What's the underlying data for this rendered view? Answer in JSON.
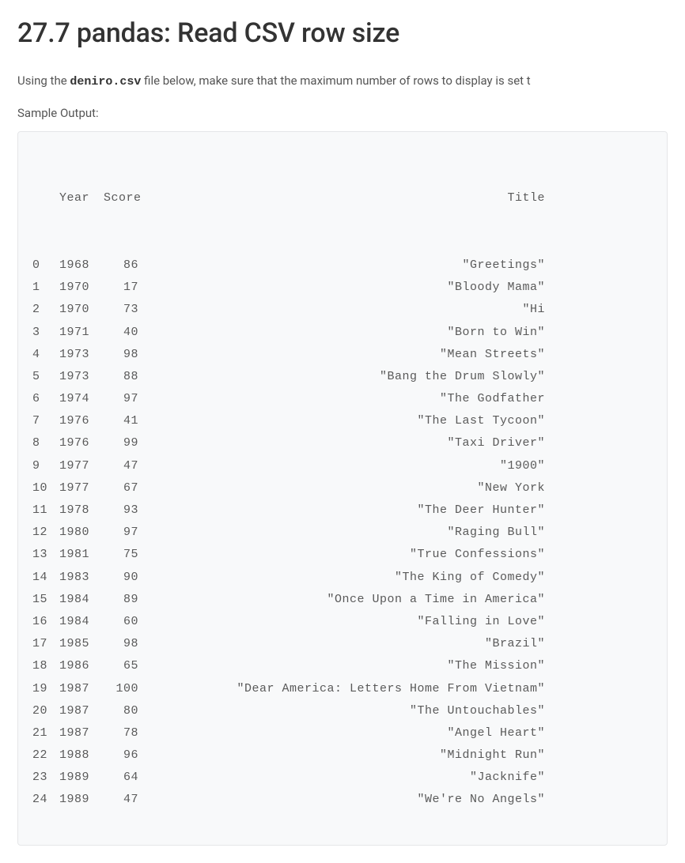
{
  "heading": "27.7 pandas: Read CSV row size",
  "intro_prefix": "Using the ",
  "intro_code": "deniro.csv",
  "intro_suffix": " file below, make sure that the maximum number of rows to display is set t",
  "sample_label": "Sample Output:",
  "chart_data": {
    "type": "table",
    "columns": [
      "Year",
      "Score",
      "Title"
    ],
    "rows": [
      {
        "index": "0",
        "Year": "1968",
        "Score": "86",
        "Title": "\"Greetings\""
      },
      {
        "index": "1",
        "Year": "1970",
        "Score": "17",
        "Title": "\"Bloody Mama\""
      },
      {
        "index": "2",
        "Year": "1970",
        "Score": "73",
        "Title": "\"Hi"
      },
      {
        "index": "3",
        "Year": "1971",
        "Score": "40",
        "Title": "\"Born to Win\""
      },
      {
        "index": "4",
        "Year": "1973",
        "Score": "98",
        "Title": "\"Mean Streets\""
      },
      {
        "index": "5",
        "Year": "1973",
        "Score": "88",
        "Title": "\"Bang the Drum Slowly\""
      },
      {
        "index": "6",
        "Year": "1974",
        "Score": "97",
        "Title": "\"The Godfather"
      },
      {
        "index": "7",
        "Year": "1976",
        "Score": "41",
        "Title": "\"The Last Tycoon\""
      },
      {
        "index": "8",
        "Year": "1976",
        "Score": "99",
        "Title": "\"Taxi Driver\""
      },
      {
        "index": "9",
        "Year": "1977",
        "Score": "47",
        "Title": "\"1900\""
      },
      {
        "index": "10",
        "Year": "1977",
        "Score": "67",
        "Title": "\"New York"
      },
      {
        "index": "11",
        "Year": "1978",
        "Score": "93",
        "Title": "\"The Deer Hunter\""
      },
      {
        "index": "12",
        "Year": "1980",
        "Score": "97",
        "Title": "\"Raging Bull\""
      },
      {
        "index": "13",
        "Year": "1981",
        "Score": "75",
        "Title": "\"True Confessions\""
      },
      {
        "index": "14",
        "Year": "1983",
        "Score": "90",
        "Title": "\"The King of Comedy\""
      },
      {
        "index": "15",
        "Year": "1984",
        "Score": "89",
        "Title": "\"Once Upon a Time in America\""
      },
      {
        "index": "16",
        "Year": "1984",
        "Score": "60",
        "Title": "\"Falling in Love\""
      },
      {
        "index": "17",
        "Year": "1985",
        "Score": "98",
        "Title": "\"Brazil\""
      },
      {
        "index": "18",
        "Year": "1986",
        "Score": "65",
        "Title": "\"The Mission\""
      },
      {
        "index": "19",
        "Year": "1987",
        "Score": "100",
        "Title": "\"Dear America: Letters Home From Vietnam\""
      },
      {
        "index": "20",
        "Year": "1987",
        "Score": "80",
        "Title": "\"The Untouchables\""
      },
      {
        "index": "21",
        "Year": "1987",
        "Score": "78",
        "Title": "\"Angel Heart\""
      },
      {
        "index": "22",
        "Year": "1988",
        "Score": "96",
        "Title": "\"Midnight Run\""
      },
      {
        "index": "23",
        "Year": "1989",
        "Score": "64",
        "Title": "\"Jacknife\""
      },
      {
        "index": "24",
        "Year": "1989",
        "Score": "47",
        "Title": "\"We're No Angels\""
      }
    ]
  }
}
